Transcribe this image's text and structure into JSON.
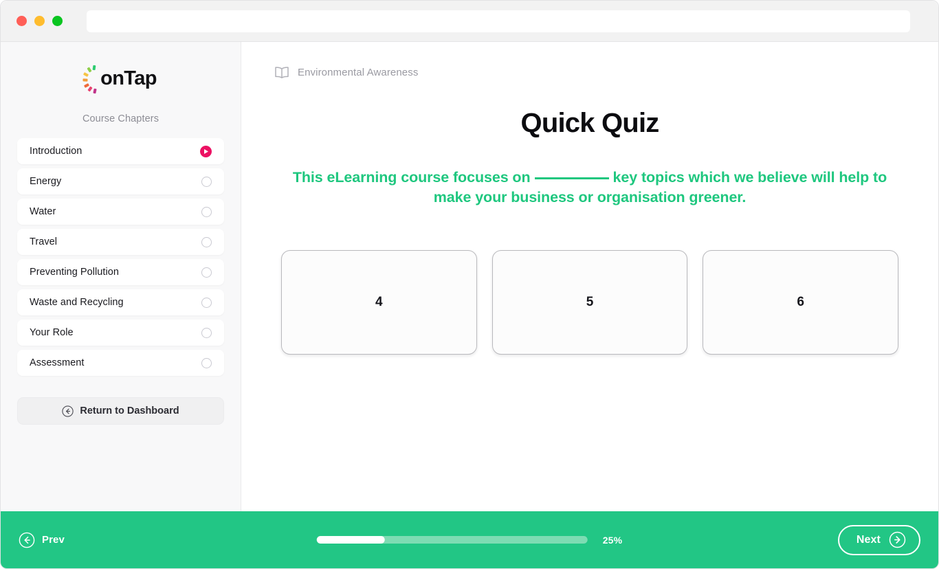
{
  "browser": {
    "address_value": "",
    "address_placeholder": "",
    "traffic_lights": [
      "close",
      "minimize",
      "maximize"
    ]
  },
  "sidebar": {
    "logo_text": "onTap",
    "logo_burst_colors": [
      "#2ecc71",
      "#f6c445",
      "#f29c38",
      "#ef6a3a",
      "#e8436f",
      "#c1338a",
      "#8fce4a"
    ],
    "heading": "Course Chapters",
    "chapters": [
      {
        "label": "Introduction",
        "status": "active"
      },
      {
        "label": "Energy",
        "status": "locked"
      },
      {
        "label": "Water",
        "status": "locked"
      },
      {
        "label": "Travel",
        "status": "locked"
      },
      {
        "label": "Preventing Pollution",
        "status": "locked"
      },
      {
        "label": "Waste and Recycling",
        "status": "locked"
      },
      {
        "label": "Your Role",
        "status": "locked"
      },
      {
        "label": "Assessment",
        "status": "locked"
      }
    ],
    "dashboard_button": "Return to Dashboard"
  },
  "main": {
    "breadcrumb": "Environmental Awareness",
    "title": "Quick Quiz",
    "question_part1": "This eLearning course focuses on",
    "question_blank": "",
    "question_part2": "key topics which we believe will help to make your business or organisation greener.",
    "answers": [
      {
        "label": "4"
      },
      {
        "label": "5"
      },
      {
        "label": "6"
      }
    ]
  },
  "footer": {
    "prev_label": "Prev",
    "next_label": "Next",
    "progress_percent": 25,
    "progress_label": "25%"
  },
  "colors": {
    "brand_green": "#22c685",
    "question_green": "#1fc77f",
    "active_pink": "#ec1163",
    "sidebar_bg": "#f8f8f9",
    "progress_track": "#7ddcb3"
  }
}
